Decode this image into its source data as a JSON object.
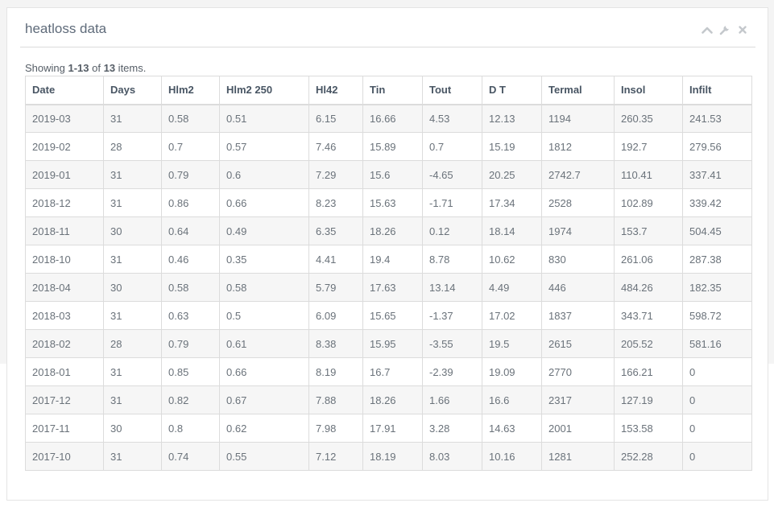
{
  "panel": {
    "title": "heatloss data"
  },
  "summary": {
    "prefix": "Showing ",
    "range": "1-13",
    "middle": " of ",
    "total": "13",
    "suffix": " items."
  },
  "table": {
    "headers": [
      "Date",
      "Days",
      "Hlm2",
      "Hlm2 250",
      "Hl42",
      "Tin",
      "Tout",
      "D T",
      "Termal",
      "Insol",
      "Infilt"
    ],
    "rows": [
      [
        "2019-03",
        "31",
        "0.58",
        "0.51",
        "6.15",
        "16.66",
        "4.53",
        "12.13",
        "1194",
        "260.35",
        "241.53"
      ],
      [
        "2019-02",
        "28",
        "0.7",
        "0.57",
        "7.46",
        "15.89",
        "0.7",
        "15.19",
        "1812",
        "192.7",
        "279.56"
      ],
      [
        "2019-01",
        "31",
        "0.79",
        "0.6",
        "7.29",
        "15.6",
        "-4.65",
        "20.25",
        "2742.7",
        "110.41",
        "337.41"
      ],
      [
        "2018-12",
        "31",
        "0.86",
        "0.66",
        "8.23",
        "15.63",
        "-1.71",
        "17.34",
        "2528",
        "102.89",
        "339.42"
      ],
      [
        "2018-11",
        "30",
        "0.64",
        "0.49",
        "6.35",
        "18.26",
        "0.12",
        "18.14",
        "1974",
        "153.7",
        "504.45"
      ],
      [
        "2018-10",
        "31",
        "0.46",
        "0.35",
        "4.41",
        "19.4",
        "8.78",
        "10.62",
        "830",
        "261.06",
        "287.38"
      ],
      [
        "2018-04",
        "30",
        "0.58",
        "0.58",
        "5.79",
        "17.63",
        "13.14",
        "4.49",
        "446",
        "484.26",
        "182.35"
      ],
      [
        "2018-03",
        "31",
        "0.63",
        "0.5",
        "6.09",
        "15.65",
        "-1.37",
        "17.02",
        "1837",
        "343.71",
        "598.72"
      ],
      [
        "2018-02",
        "28",
        "0.79",
        "0.61",
        "8.38",
        "15.95",
        "-3.55",
        "19.5",
        "2615",
        "205.52",
        "581.16"
      ],
      [
        "2018-01",
        "31",
        "0.85",
        "0.66",
        "8.19",
        "16.7",
        "-2.39",
        "19.09",
        "2770",
        "166.21",
        "0"
      ],
      [
        "2017-12",
        "31",
        "0.82",
        "0.67",
        "7.88",
        "18.26",
        "1.66",
        "16.6",
        "2317",
        "127.19",
        "0"
      ],
      [
        "2017-11",
        "30",
        "0.8",
        "0.62",
        "7.98",
        "17.91",
        "3.28",
        "14.63",
        "2001",
        "153.58",
        "0"
      ],
      [
        "2017-10",
        "31",
        "0.74",
        "0.55",
        "7.12",
        "18.19",
        "8.03",
        "10.16",
        "1281",
        "252.28",
        "0"
      ]
    ]
  },
  "icons": {
    "collapse": "chevron-up-icon",
    "settings": "wrench-icon",
    "close": "close-icon"
  },
  "colors": {
    "title": "#5f6b7a",
    "icon": "#c4c8cc",
    "header_text": "#485563"
  }
}
